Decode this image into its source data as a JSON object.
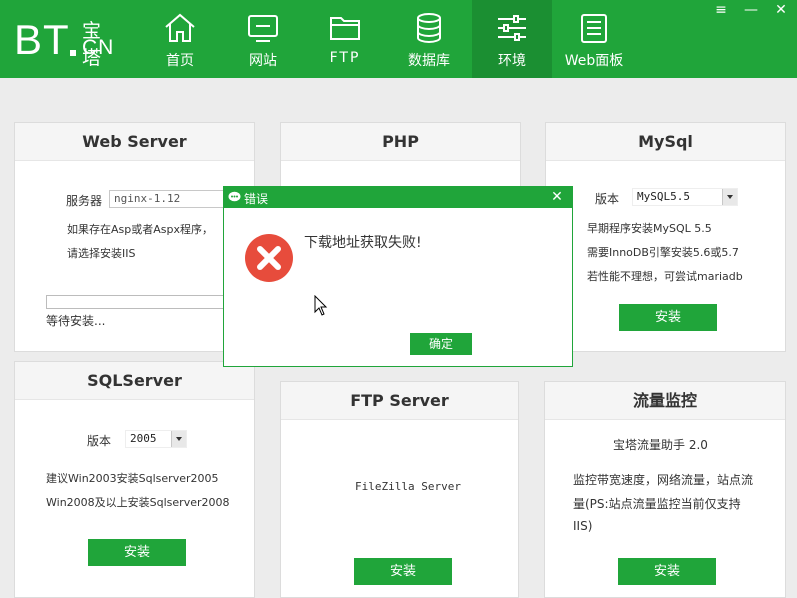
{
  "logo": {
    "bt": "BT",
    "cn_top": "宝塔",
    "cn_bottom": "CN"
  },
  "nav": [
    {
      "label": "首页",
      "icon": "home-icon"
    },
    {
      "label": "网站",
      "icon": "monitor-icon"
    },
    {
      "label": "FTP",
      "icon": "folder-icon"
    },
    {
      "label": "数据库",
      "icon": "database-icon"
    },
    {
      "label": "环境",
      "icon": "sliders-icon",
      "active": true
    },
    {
      "label": "Web面板",
      "icon": "panel-list-icon"
    }
  ],
  "window_controls": {
    "menu": "≡",
    "minimize": "—",
    "close": "✕"
  },
  "cards": {
    "web_server": {
      "title": "Web Server",
      "server_label": "服务器",
      "server_value": "nginx-1.12",
      "note_line1": "如果存在Asp或者Aspx程序，",
      "note_line2": "请选择安装IIS",
      "status": "等待安装..."
    },
    "php": {
      "title": "PHP"
    },
    "mysql": {
      "title": "MySql",
      "version_label": "版本",
      "version_value": "MySQL5.5",
      "line1": "早期程序安装MySQL 5.5",
      "line2": "需要InnoDB引擎安装5.6或5.7",
      "line3": "若性能不理想，可尝试mariadb",
      "button": "安装"
    },
    "sqlserver": {
      "title": "SQLServer",
      "version_label": "版本",
      "version_value": "2005",
      "line1": "建议Win2003安装Sqlserver2005",
      "line2": "Win2008及以上安装Sqlserver2008",
      "button": "安装"
    },
    "ftp_server": {
      "title": "FTP Server",
      "product": "FileZilla Server",
      "button": "安装"
    },
    "traffic": {
      "title": "流量监控",
      "product": "宝塔流量助手 2.0",
      "line1": "监控带宽速度，网络流量，站点流",
      "line2": "量(PS:站点流量监控当前仅支持",
      "line3": "IIS)",
      "button": "安装"
    }
  },
  "dialog": {
    "title": "错误",
    "message": "下载地址获取失败!",
    "ok": "确定",
    "close": "✕",
    "icon": "error-icon"
  },
  "colors": {
    "brand": "#20a53a",
    "brand_dark": "#1b8f32",
    "error": "#e74c3c"
  }
}
